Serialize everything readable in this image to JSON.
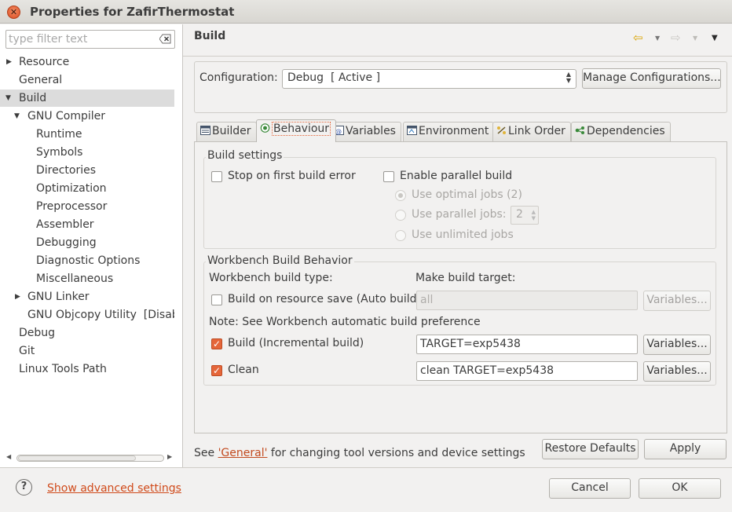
{
  "window": {
    "title": "Properties for ZafirThermostat",
    "close_glyph": "✕"
  },
  "sidebar": {
    "filter_placeholder": "type filter text",
    "items": [
      {
        "label": "Resource",
        "expander": "▶"
      },
      {
        "label": "General"
      },
      {
        "label": "Build",
        "expander": "▼",
        "selected": true
      },
      {
        "label": "GNU Compiler",
        "expander": "▼"
      },
      {
        "label": "Runtime"
      },
      {
        "label": "Symbols"
      },
      {
        "label": "Directories"
      },
      {
        "label": "Optimization"
      },
      {
        "label": "Preprocessor"
      },
      {
        "label": "Assembler"
      },
      {
        "label": "Debugging"
      },
      {
        "label": "Diagnostic Options"
      },
      {
        "label": "Miscellaneous"
      },
      {
        "label": "GNU Linker",
        "expander": "▶"
      },
      {
        "label": "GNU Objcopy Utility  [Disabl"
      },
      {
        "label": "Debug"
      },
      {
        "label": "Git"
      },
      {
        "label": "Linux Tools Path"
      }
    ],
    "scroll_left": "◀",
    "scroll_right": "▶"
  },
  "page": {
    "title": "Build",
    "nav": {
      "back_icon": "⇦",
      "back_menu": "▼",
      "forward_icon": "⇨",
      "forward_menu": "▼",
      "view_menu": "▼"
    }
  },
  "configuration": {
    "label": "Configuration:",
    "selected": "Debug  [ Active ]",
    "manage_button": "Manage Configurations..."
  },
  "tabs": [
    {
      "label": "Builder",
      "icon": "builder-icon"
    },
    {
      "label": "Behaviour",
      "icon": "behaviour-icon",
      "active": true
    },
    {
      "label": "Variables",
      "icon": "variables-icon"
    },
    {
      "label": "Environment",
      "icon": "environment-icon"
    },
    {
      "label": "Link Order",
      "icon": "link-order-icon"
    },
    {
      "label": "Dependencies",
      "icon": "dependencies-icon"
    }
  ],
  "build_settings": {
    "legend": "Build settings",
    "stop_on_first_error": {
      "label": "Stop on first build error",
      "checked": false
    },
    "enable_parallel": {
      "label": "Enable parallel build",
      "checked": false
    },
    "use_optimal_jobs": {
      "label": "Use optimal jobs (2)",
      "selected": true
    },
    "use_parallel_jobs": {
      "label": "Use parallel jobs:",
      "value": "2"
    },
    "use_unlimited_jobs": {
      "label": "Use unlimited jobs"
    }
  },
  "workbench": {
    "legend": "Workbench Build Behavior",
    "type_header": "Workbench build type:",
    "target_header": "Make build target:",
    "auto_build": {
      "label": "Build on resource save (Auto build)",
      "checked": false,
      "target": "all",
      "variables_button": "Variables..."
    },
    "note": "Note: See Workbench automatic build preference",
    "incremental": {
      "label": "Build (Incremental build)",
      "checked": true,
      "target": "TARGET=exp5438",
      "variables_button": "Variables..."
    },
    "clean": {
      "label": "Clean",
      "checked": true,
      "target": "clean TARGET=exp5438",
      "variables_button": "Variables..."
    }
  },
  "footer": {
    "note_prefix": "See ",
    "note_link": "'General'",
    "note_suffix": " for changing tool versions and device settings",
    "restore_defaults": "Restore Defaults",
    "apply": "Apply",
    "help_glyph": "?",
    "advanced_link": "Show advanced settings",
    "cancel": "Cancel",
    "ok": "OK"
  },
  "colors": {
    "window_bg": "#f2f1f0",
    "accent": "#e5663a",
    "link": "#c24a1f"
  }
}
